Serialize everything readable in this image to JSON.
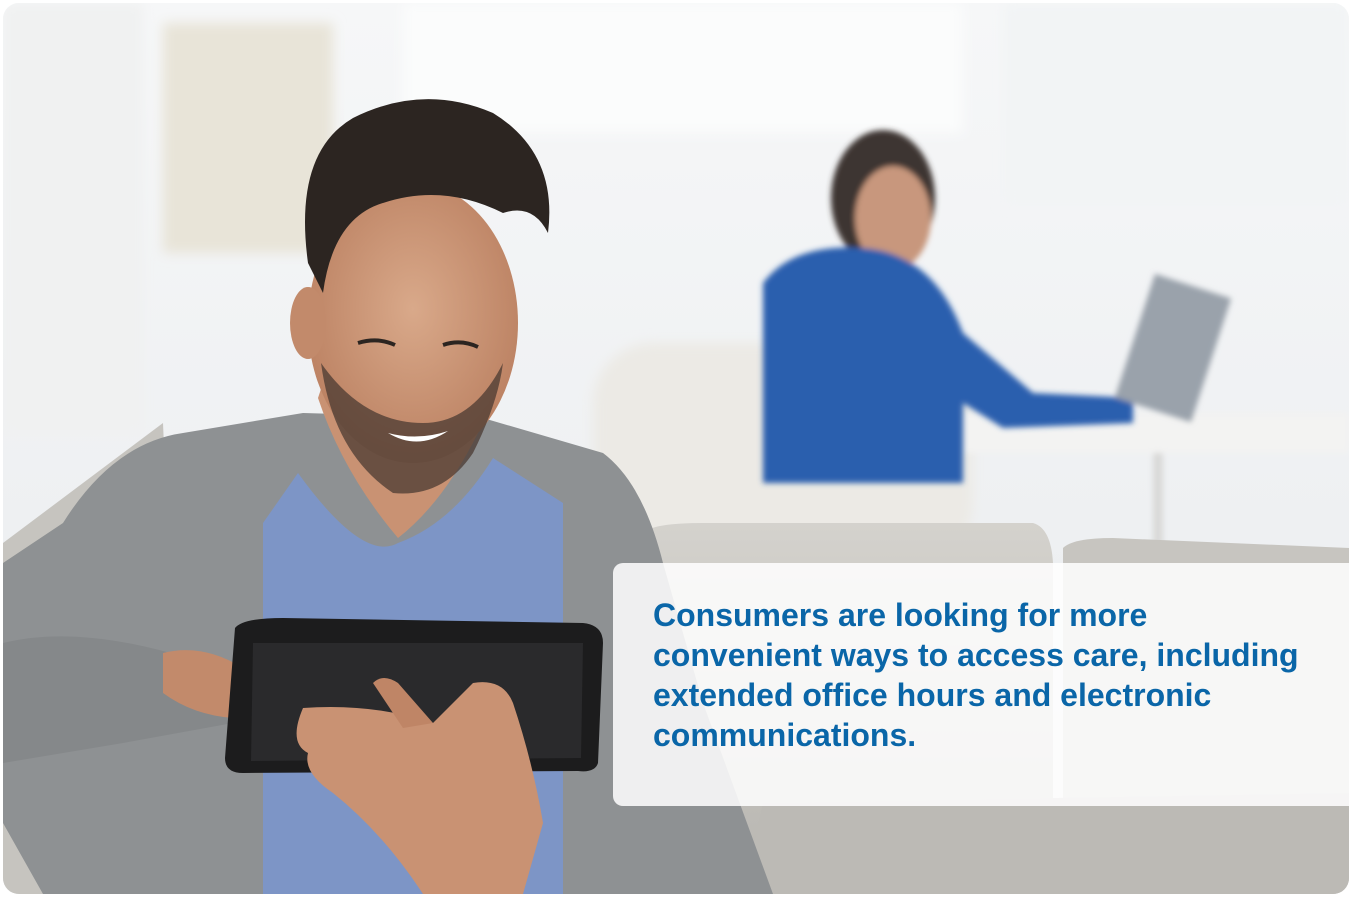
{
  "caption": {
    "text": "Consumers are looking for more convenient ways to access care, including extended office hours and electronic communications."
  },
  "colors": {
    "caption_text": "#0a66a8",
    "caption_box": "#ffffff",
    "shirt_blue": "#7d95c6",
    "cardigan_grey": "#8e9193",
    "sofa_grey": "#c4c2bd",
    "woman_sweater": "#2a5fae"
  },
  "icons": {
    "photo": "lifestyle-photo"
  }
}
